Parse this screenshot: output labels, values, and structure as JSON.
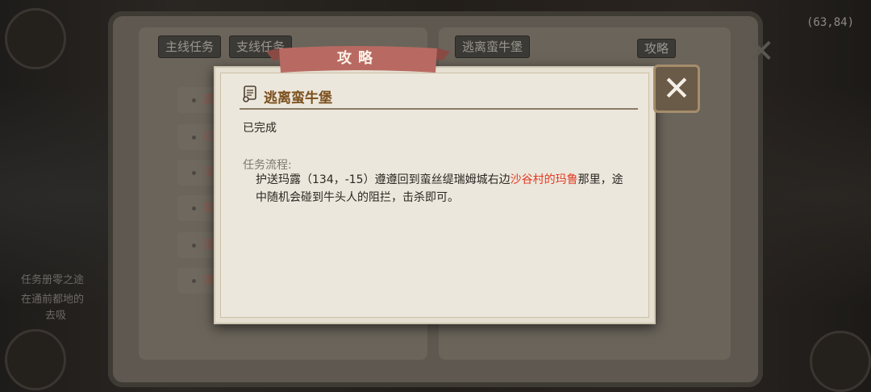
{
  "background": {
    "coords": "(63,84)",
    "left_text_1": "任务册零之途",
    "left_text_2": "在通前都地的",
    "left_text_3": "去吸"
  },
  "book": {
    "tabs": {
      "main": "主线任务",
      "side": "支线任务",
      "right_quest": "逃离蛮牛堡",
      "guide": "攻略"
    },
    "list_items": [
      "逃离",
      "红色",
      "宝石",
      "紫色",
      "镜华",
      "镜华"
    ]
  },
  "dialog": {
    "ribbon_title": "攻略",
    "title": "逃离蛮牛堡",
    "status": "已完成",
    "flow_label": "任务流程:",
    "desc_part1": "护送玛露（134，-15）遵遵回到蛮丝缇瑞姆城右边",
    "desc_highlight": "沙谷村的玛鲁",
    "desc_part2": "那里，途中随机会碰到牛头人的阻拦，击杀即可。",
    "close_symbol": "✕"
  },
  "colors": {
    "highlight": "#e43a22",
    "title": "#7a4e1c",
    "ribbon": "#b86a62"
  }
}
